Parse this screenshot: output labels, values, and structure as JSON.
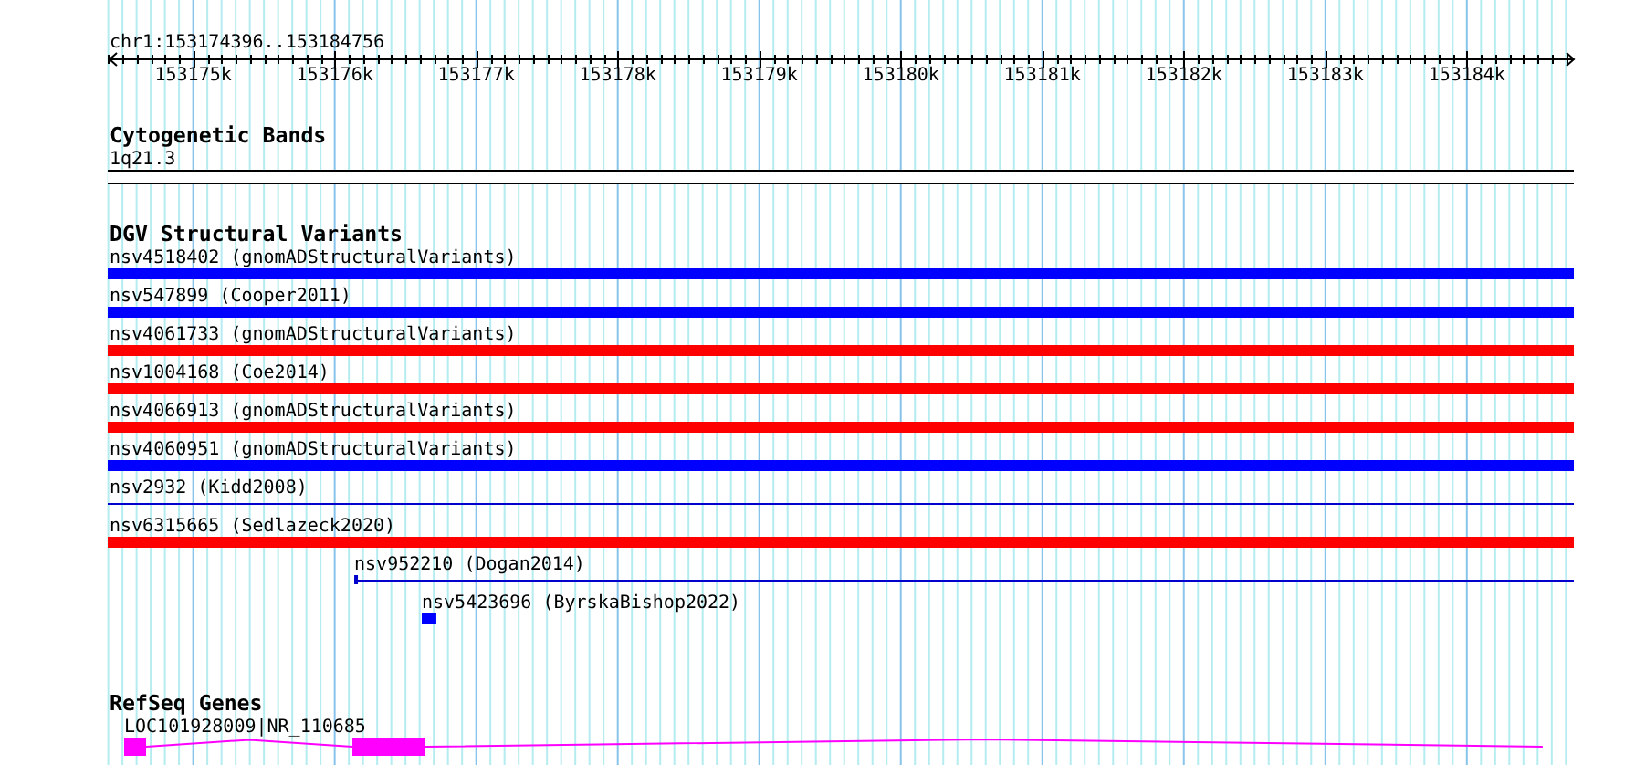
{
  "ruler": {
    "location": "chr1:153174396..153184756",
    "tick_labels": [
      "153175k",
      "153176k",
      "153177k",
      "153178k",
      "153179k",
      "153180k",
      "153181k",
      "153182k",
      "153183k",
      "153184k"
    ]
  },
  "tracks": [
    {
      "kind": "cytoband",
      "title": "Cytogenetic Bands",
      "features": [
        {
          "label": "1q21.3"
        }
      ]
    },
    {
      "kind": "variants",
      "title": "DGV Structural Variants",
      "features": [
        {
          "label": "nsv4518402 (gnomADStructuralVariants)",
          "kind": "bar",
          "color": "#0000ff"
        },
        {
          "label": "nsv547899 (Cooper2011)",
          "kind": "bar",
          "color": "#0000ff"
        },
        {
          "label": "nsv4061733 (gnomADStructuralVariants)",
          "kind": "bar",
          "color": "#ff0000"
        },
        {
          "label": "nsv1004168 (Coe2014)",
          "kind": "bar",
          "color": "#ff0000"
        },
        {
          "label": "nsv4066913 (gnomADStructuralVariants)",
          "kind": "bar",
          "color": "#ff0000"
        },
        {
          "label": "nsv4060951 (gnomADStructuralVariants)",
          "kind": "bar",
          "color": "#0000ff"
        },
        {
          "label": "nsv2932 (Kidd2008)",
          "kind": "line",
          "color": "#0000cc"
        },
        {
          "label": "nsv6315665 (Sedlazeck2020)",
          "kind": "bar",
          "color": "#ff0000"
        },
        {
          "label": "nsv952210 (Dogan2014)",
          "kind": "line",
          "color": "#0000cc"
        },
        {
          "label": "nsv5423696 (ByrskaBishop2022)",
          "kind": "bar",
          "color": "#0000ff"
        }
      ]
    },
    {
      "kind": "genes",
      "title": "RefSeq Genes",
      "features": [
        {
          "label": "LOC101928009|NR_110685",
          "color": "#ff00ff"
        }
      ]
    }
  ]
}
